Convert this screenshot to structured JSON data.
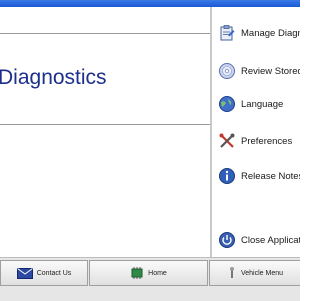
{
  "main": {
    "title": "Diagnostics"
  },
  "menu": {
    "items": [
      {
        "label": "Manage Diagnostic",
        "icon": "clipboard-icon"
      },
      {
        "label": "Review Stored",
        "icon": "disc-icon"
      },
      {
        "label": "Language",
        "icon": "globe-icon"
      },
      {
        "label": "Preferences",
        "icon": "tools-icon"
      },
      {
        "label": "Release Notes",
        "icon": "info-icon"
      },
      {
        "label": "Close Application",
        "icon": "power-icon"
      }
    ]
  },
  "bottom_nav": {
    "contact": {
      "label": "Contact Us",
      "icon": "envelope-icon"
    },
    "home": {
      "label": "Home",
      "icon": "chip-icon"
    },
    "vehicle": {
      "label": "Vehicle Menu",
      "icon": "wrench-icon"
    }
  },
  "colors": {
    "title_text": "#1d2f8a",
    "titlebar": "#1b5ad6",
    "divider": "#9a9a9a"
  }
}
